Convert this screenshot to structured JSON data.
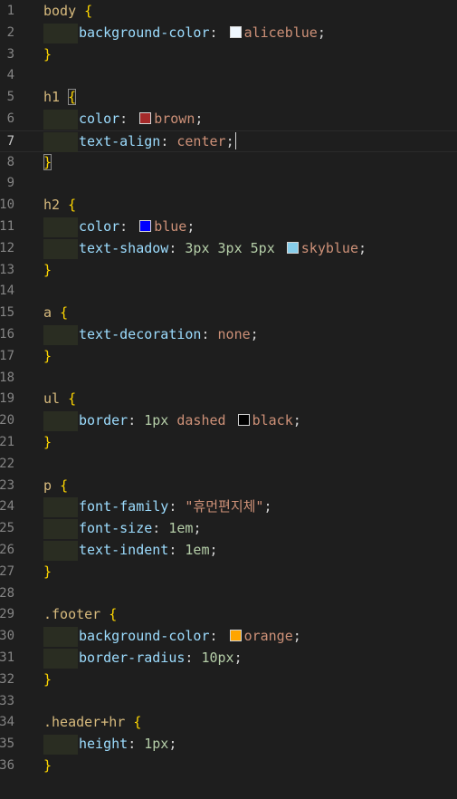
{
  "lines": [
    {
      "n": "1",
      "tokens": [
        {
          "t": "body",
          "c": "sel"
        },
        {
          "t": " ",
          "c": "punc"
        },
        {
          "t": "{",
          "c": "br"
        }
      ]
    },
    {
      "n": "2",
      "indent": true,
      "tokens": [
        {
          "t": "background-color",
          "c": "prop"
        },
        {
          "t": ": ",
          "c": "punc"
        },
        {
          "sw": "#f0f8ff"
        },
        {
          "t": "aliceblue",
          "c": "val"
        },
        {
          "t": ";",
          "c": "punc"
        }
      ]
    },
    {
      "n": "3",
      "tokens": [
        {
          "t": "}",
          "c": "br"
        }
      ]
    },
    {
      "n": "4",
      "tokens": []
    },
    {
      "n": "5",
      "tokens": [
        {
          "t": "h1",
          "c": "sel"
        },
        {
          "t": " ",
          "c": "punc"
        },
        {
          "t": "{",
          "c": "br match"
        }
      ]
    },
    {
      "n": "6",
      "indent": true,
      "tokens": [
        {
          "t": "color",
          "c": "prop"
        },
        {
          "t": ": ",
          "c": "punc"
        },
        {
          "sw": "#a52a2a"
        },
        {
          "t": "brown",
          "c": "val"
        },
        {
          "t": ";",
          "c": "punc"
        }
      ]
    },
    {
      "n": "7",
      "indent": true,
      "active": true,
      "tokens": [
        {
          "t": "text-align",
          "c": "prop"
        },
        {
          "t": ": ",
          "c": "punc"
        },
        {
          "t": "center",
          "c": "val"
        },
        {
          "t": ";",
          "c": "punc"
        },
        {
          "caret": true
        }
      ]
    },
    {
      "n": "8",
      "tokens": [
        {
          "t": "}",
          "c": "br match"
        }
      ]
    },
    {
      "n": "9",
      "tokens": []
    },
    {
      "n": "10",
      "tokens": [
        {
          "t": "h2",
          "c": "sel"
        },
        {
          "t": " ",
          "c": "punc"
        },
        {
          "t": "{",
          "c": "br"
        }
      ]
    },
    {
      "n": "11",
      "indent": true,
      "tokens": [
        {
          "t": "color",
          "c": "prop"
        },
        {
          "t": ": ",
          "c": "punc"
        },
        {
          "sw": "#0000ff"
        },
        {
          "t": "blue",
          "c": "val"
        },
        {
          "t": ";",
          "c": "punc"
        }
      ]
    },
    {
      "n": "12",
      "indent": true,
      "tokens": [
        {
          "t": "text-shadow",
          "c": "prop"
        },
        {
          "t": ": ",
          "c": "punc"
        },
        {
          "t": "3px",
          "c": "num"
        },
        {
          "t": " ",
          "c": "punc"
        },
        {
          "t": "3px",
          "c": "num"
        },
        {
          "t": " ",
          "c": "punc"
        },
        {
          "t": "5px",
          "c": "num"
        },
        {
          "t": " ",
          "c": "punc"
        },
        {
          "sw": "#87ceeb"
        },
        {
          "t": "skyblue",
          "c": "val"
        },
        {
          "t": ";",
          "c": "punc"
        }
      ]
    },
    {
      "n": "13",
      "tokens": [
        {
          "t": "}",
          "c": "br"
        }
      ]
    },
    {
      "n": "14",
      "tokens": []
    },
    {
      "n": "15",
      "tokens": [
        {
          "t": "a",
          "c": "sel"
        },
        {
          "t": " ",
          "c": "punc"
        },
        {
          "t": "{",
          "c": "br"
        }
      ]
    },
    {
      "n": "16",
      "indent": true,
      "tokens": [
        {
          "t": "text-decoration",
          "c": "prop"
        },
        {
          "t": ": ",
          "c": "punc"
        },
        {
          "t": "none",
          "c": "val"
        },
        {
          "t": ";",
          "c": "punc"
        }
      ]
    },
    {
      "n": "17",
      "tokens": [
        {
          "t": "}",
          "c": "br"
        }
      ]
    },
    {
      "n": "18",
      "tokens": []
    },
    {
      "n": "19",
      "tokens": [
        {
          "t": "ul",
          "c": "sel"
        },
        {
          "t": " ",
          "c": "punc"
        },
        {
          "t": "{",
          "c": "br"
        }
      ]
    },
    {
      "n": "20",
      "indent": true,
      "tokens": [
        {
          "t": "border",
          "c": "prop"
        },
        {
          "t": ": ",
          "c": "punc"
        },
        {
          "t": "1px",
          "c": "num"
        },
        {
          "t": " ",
          "c": "punc"
        },
        {
          "t": "dashed",
          "c": "val"
        },
        {
          "t": " ",
          "c": "punc"
        },
        {
          "sw": "#000000"
        },
        {
          "t": "black",
          "c": "val"
        },
        {
          "t": ";",
          "c": "punc"
        }
      ]
    },
    {
      "n": "21",
      "tokens": [
        {
          "t": "}",
          "c": "br"
        }
      ]
    },
    {
      "n": "22",
      "tokens": []
    },
    {
      "n": "23",
      "tokens": [
        {
          "t": "p",
          "c": "sel"
        },
        {
          "t": " ",
          "c": "punc"
        },
        {
          "t": "{",
          "c": "br"
        }
      ]
    },
    {
      "n": "24",
      "indent": true,
      "tokens": [
        {
          "t": "font-family",
          "c": "prop"
        },
        {
          "t": ": ",
          "c": "punc"
        },
        {
          "t": "\"휴먼편지체\"",
          "c": "val"
        },
        {
          "t": ";",
          "c": "punc"
        }
      ]
    },
    {
      "n": "25",
      "indent": true,
      "tokens": [
        {
          "t": "font-size",
          "c": "prop"
        },
        {
          "t": ": ",
          "c": "punc"
        },
        {
          "t": "1em",
          "c": "num"
        },
        {
          "t": ";",
          "c": "punc"
        }
      ]
    },
    {
      "n": "26",
      "indent": true,
      "tokens": [
        {
          "t": "text-indent",
          "c": "prop"
        },
        {
          "t": ": ",
          "c": "punc"
        },
        {
          "t": "1em",
          "c": "num"
        },
        {
          "t": ";",
          "c": "punc"
        }
      ]
    },
    {
      "n": "27",
      "tokens": [
        {
          "t": "}",
          "c": "br"
        }
      ]
    },
    {
      "n": "28",
      "tokens": []
    },
    {
      "n": "29",
      "tokens": [
        {
          "t": ".footer",
          "c": "sel"
        },
        {
          "t": " ",
          "c": "punc"
        },
        {
          "t": "{",
          "c": "br"
        }
      ]
    },
    {
      "n": "30",
      "indent": true,
      "tokens": [
        {
          "t": "background-color",
          "c": "prop"
        },
        {
          "t": ": ",
          "c": "punc"
        },
        {
          "sw": "#ffa500"
        },
        {
          "t": "orange",
          "c": "val"
        },
        {
          "t": ";",
          "c": "punc"
        }
      ]
    },
    {
      "n": "31",
      "indent": true,
      "tokens": [
        {
          "t": "border-radius",
          "c": "prop"
        },
        {
          "t": ": ",
          "c": "punc"
        },
        {
          "t": "10px",
          "c": "num"
        },
        {
          "t": ";",
          "c": "punc"
        }
      ]
    },
    {
      "n": "32",
      "tokens": [
        {
          "t": "}",
          "c": "br"
        }
      ]
    },
    {
      "n": "33",
      "tokens": []
    },
    {
      "n": "34",
      "tokens": [
        {
          "t": ".header+hr",
          "c": "sel"
        },
        {
          "t": " ",
          "c": "punc"
        },
        {
          "t": "{",
          "c": "br"
        }
      ]
    },
    {
      "n": "35",
      "indent": true,
      "tokens": [
        {
          "t": "height",
          "c": "prop"
        },
        {
          "t": ": ",
          "c": "punc"
        },
        {
          "t": "1px",
          "c": "num"
        },
        {
          "t": ";",
          "c": "punc"
        }
      ]
    },
    {
      "n": "36",
      "tokens": [
        {
          "t": "}",
          "c": "br"
        }
      ]
    }
  ]
}
